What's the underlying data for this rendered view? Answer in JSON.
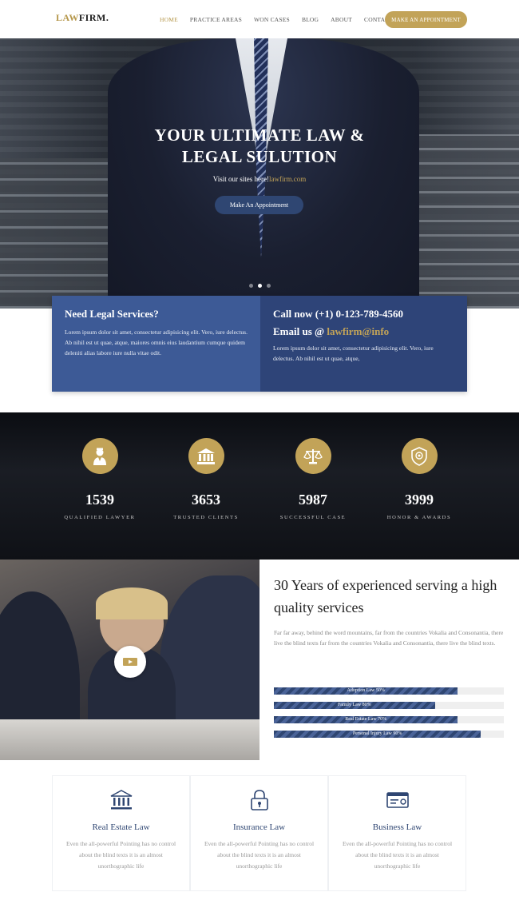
{
  "nav": {
    "logo_law": "LAW",
    "logo_firm": "FIRM.",
    "items": [
      {
        "label": "HOME",
        "active": true
      },
      {
        "label": "PRACTICE AREAS",
        "active": false
      },
      {
        "label": "WON CASES",
        "active": false
      },
      {
        "label": "BLOG",
        "active": false
      },
      {
        "label": "ABOUT",
        "active": false
      },
      {
        "label": "CONTACT",
        "active": false
      }
    ],
    "cta": "MAKE AN APPOINTMENT"
  },
  "hero": {
    "title_line1": "YOUR ULTIMATE LAW &",
    "title_line2": "LEGAL SULUTION",
    "sub_prefix": "Visit our sites here!",
    "sub_link": "lawfirm.com",
    "button": "Make An Appointment",
    "slides": 3,
    "active_slide": 2
  },
  "info": {
    "left_title": "Need Legal Services?",
    "left_text": "Lorem ipsum dolor sit amet, consectetur adipisicing elit. Vero, iure delectus. Ab nihil est ut quae, atque, maiores omnis eius laudantium cumque quidem deleniti alias labore iure nulla vitae odit.",
    "call": "Call now (+1) 0-123-789-4560",
    "email_prefix": "Email us @ ",
    "email": "lawfirm@info",
    "right_text": "Lorem ipsum dolor sit amet, consectetur adipisicing elit. Vero, iure delectus. Ab nihil est ut quae, atque,"
  },
  "stats": [
    {
      "icon": "lawyer-icon",
      "value": "1539",
      "label": "QUALIFIED LAWYER"
    },
    {
      "icon": "courthouse-icon",
      "value": "3653",
      "label": "TRUSTED CLIENTS"
    },
    {
      "icon": "scales-icon",
      "value": "5987",
      "label": "SUCCESSFUL CASE"
    },
    {
      "icon": "award-badge-icon",
      "value": "3999",
      "label": "HONOR & AWARDS"
    }
  ],
  "about": {
    "heading": "30 Years of experienced serving a high quality services",
    "text": "Far far away, behind the word mountains, far from the countries Vokalia and Consonantia, there live the blind texts far from the countries Vokalia and Consonantia, there live the blind texts.",
    "skills": [
      {
        "label": "Adoption Law 50%",
        "percent": 80
      },
      {
        "label": "Family Law 80%",
        "percent": 70
      },
      {
        "label": "Real Estate Law 70%",
        "percent": 80
      },
      {
        "label": "Personal Injury Law 90%",
        "percent": 90
      }
    ]
  },
  "services": [
    {
      "icon": "building-columns-icon",
      "title": "Real Estate Law",
      "text": "Even the all-powerful Pointing has no control about the blind texts it is an almost unorthographic life"
    },
    {
      "icon": "padlock-icon",
      "title": "Insurance Law",
      "text": "Even the all-powerful Pointing has no control about the blind texts it is an almost unorthographic life"
    },
    {
      "icon": "briefcase-card-icon",
      "title": "Business Law",
      "text": "Even the all-powerful Pointing has no control about the blind texts it is an almost unorthographic life"
    }
  ],
  "colors": {
    "gold": "#c2a358",
    "navy": "#2f4672",
    "blue": "#3d5a96"
  }
}
